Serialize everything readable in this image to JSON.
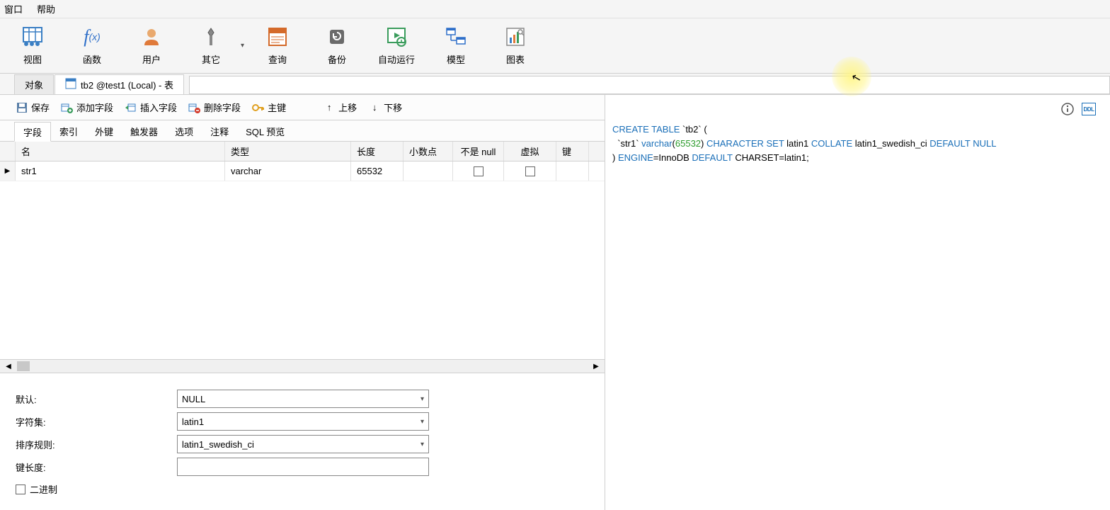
{
  "menu": {
    "window": "窗口",
    "help": "帮助"
  },
  "toolbar": {
    "view": "视图",
    "function": "函数",
    "user": "用户",
    "other": "其它",
    "query": "查询",
    "backup": "备份",
    "autorun": "自动运行",
    "model": "模型",
    "chart": "图表"
  },
  "tabs": {
    "objects": "对象",
    "current": "tb2 @test1 (Local) - 表"
  },
  "action": {
    "save": "保存",
    "add_field": "添加字段",
    "insert_field": "插入字段",
    "delete_field": "删除字段",
    "primary_key": "主键",
    "move_up": "上移",
    "move_down": "下移"
  },
  "subtabs": {
    "field": "字段",
    "index": "索引",
    "foreign_key": "外键",
    "trigger": "触发器",
    "option": "选项",
    "comment": "注释",
    "sql_preview": "SQL 预览"
  },
  "grid": {
    "headers": {
      "name": "名",
      "type": "类型",
      "length": "长度",
      "decimal": "小数点",
      "notnull": "不是 null",
      "virtual": "虚拟",
      "key": "键"
    },
    "row0": {
      "name": "str1",
      "type": "varchar",
      "length": "65532",
      "decimal": "",
      "notnull": false,
      "virtual": false,
      "key": ""
    }
  },
  "props": {
    "default_label": "默认:",
    "default_value": "NULL",
    "charset_label": "字符集:",
    "charset_value": "latin1",
    "collation_label": "排序规则:",
    "collation_value": "latin1_swedish_ci",
    "keylen_label": "键长度:",
    "keylen_value": "",
    "binary_label": "二进制"
  },
  "right": {
    "info_icon": "info-icon",
    "ddl_icon": "DDL"
  },
  "sql": {
    "t1": "CREATE TABLE",
    "t2": " `tb2` (",
    "t3": "  `str1` ",
    "t4": "varchar",
    "t5": "(",
    "t6": "65532",
    "t7": ") ",
    "t8": "CHARACTER SET",
    "t9": " latin1 ",
    "t10": "COLLATE",
    "t11": " latin1_swedish_ci ",
    "t12": "DEFAULT NULL",
    "t13": ") ",
    "t14": "ENGINE",
    "t15": "=InnoDB ",
    "t16": "DEFAULT",
    "t17": " CHARSET=latin1;"
  }
}
